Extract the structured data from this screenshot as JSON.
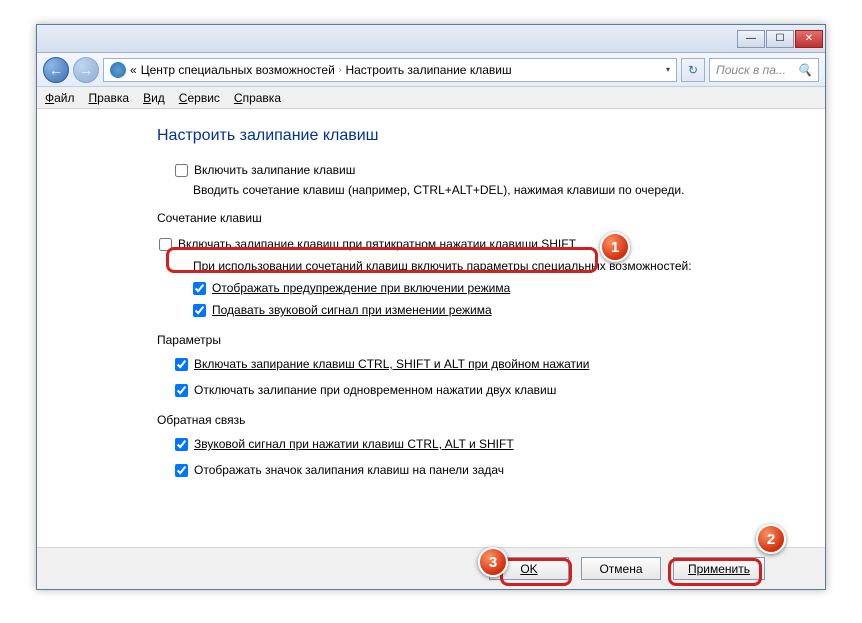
{
  "window": {
    "min_icon": "—",
    "max_icon": "☐",
    "close_icon": "✕"
  },
  "nav": {
    "back_icon": "←",
    "fwd_icon": "→",
    "bc_prefix": "«",
    "bc_parent": "Центр специальных возможностей",
    "bc_sep": "›",
    "bc_current": "Настроить залипание клавиш",
    "refresh_icon": "↻",
    "search_placeholder": "Поиск в па..."
  },
  "menu": {
    "file": "Файл",
    "edit": "Правка",
    "view": "Вид",
    "tools": "Сервис",
    "help": "Справка"
  },
  "page": {
    "title": "Настроить залипание клавиш",
    "enable_label": "Включить залипание клавиш",
    "enable_hint": "Вводить сочетание клавиш (например, CTRL+ALT+DEL), нажимая клавиши по очереди.",
    "section_shortcut": "Сочетание клавиш",
    "shift5_label": "Включать залипание клавиш при пятикратном нажатии клавиши SHIFT",
    "shortcut_hint": "При использовании сочетаний клавиш включить параметры специальных возможностей:",
    "warn_label": "Отображать предупреждение при включении режима",
    "sound_label": "Подавать звуковой сигнал при изменении режима",
    "section_params": "Параметры",
    "lock_label": "Включать запирание клавиш CTRL, SHIFT и ALT при двойном нажатии",
    "disable2_label": "Отключать залипание при одновременном нажатии двух клавиш",
    "section_feedback": "Обратная связь",
    "beep_label": "Звуковой сигнал при нажатии клавиш CTRL, ALT и SHIFT",
    "tray_label": "Отображать значок залипания клавиш на панели задач"
  },
  "buttons": {
    "ok": "OK",
    "cancel": "Отмена",
    "apply": "Применить"
  },
  "annotations": {
    "b1": "1",
    "b2": "2",
    "b3": "3"
  }
}
